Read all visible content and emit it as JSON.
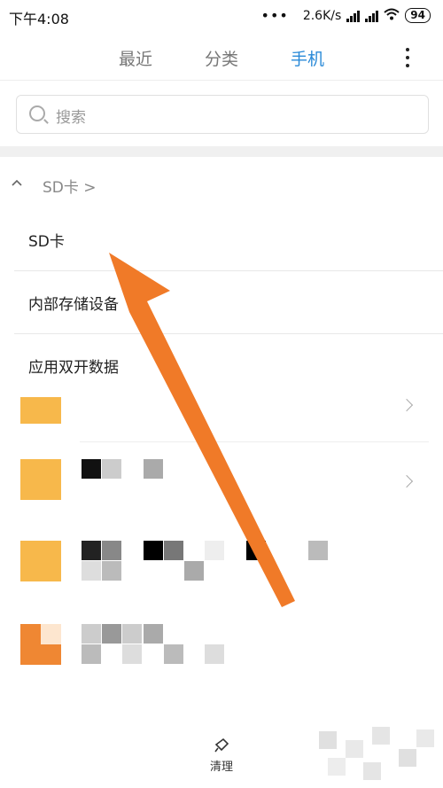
{
  "status": {
    "time": "下午4:08",
    "dots": "•••",
    "speed": "2.6K/s",
    "battery": "94"
  },
  "tabs": [
    {
      "label": "最近"
    },
    {
      "label": "分类"
    },
    {
      "label": "手机"
    }
  ],
  "active_tab": "手机",
  "search": {
    "placeholder": "搜索"
  },
  "breadcrumb": {
    "up": "^",
    "path": "SD卡 >"
  },
  "storage_menu": {
    "items": [
      "SD卡",
      "内部存储设备",
      "应用双开数据"
    ]
  },
  "bottom": {
    "clean_label": "清理"
  },
  "colors": {
    "accent": "#2a8ad8",
    "folder": "#f7b84b",
    "arrow": "#f07a28"
  }
}
